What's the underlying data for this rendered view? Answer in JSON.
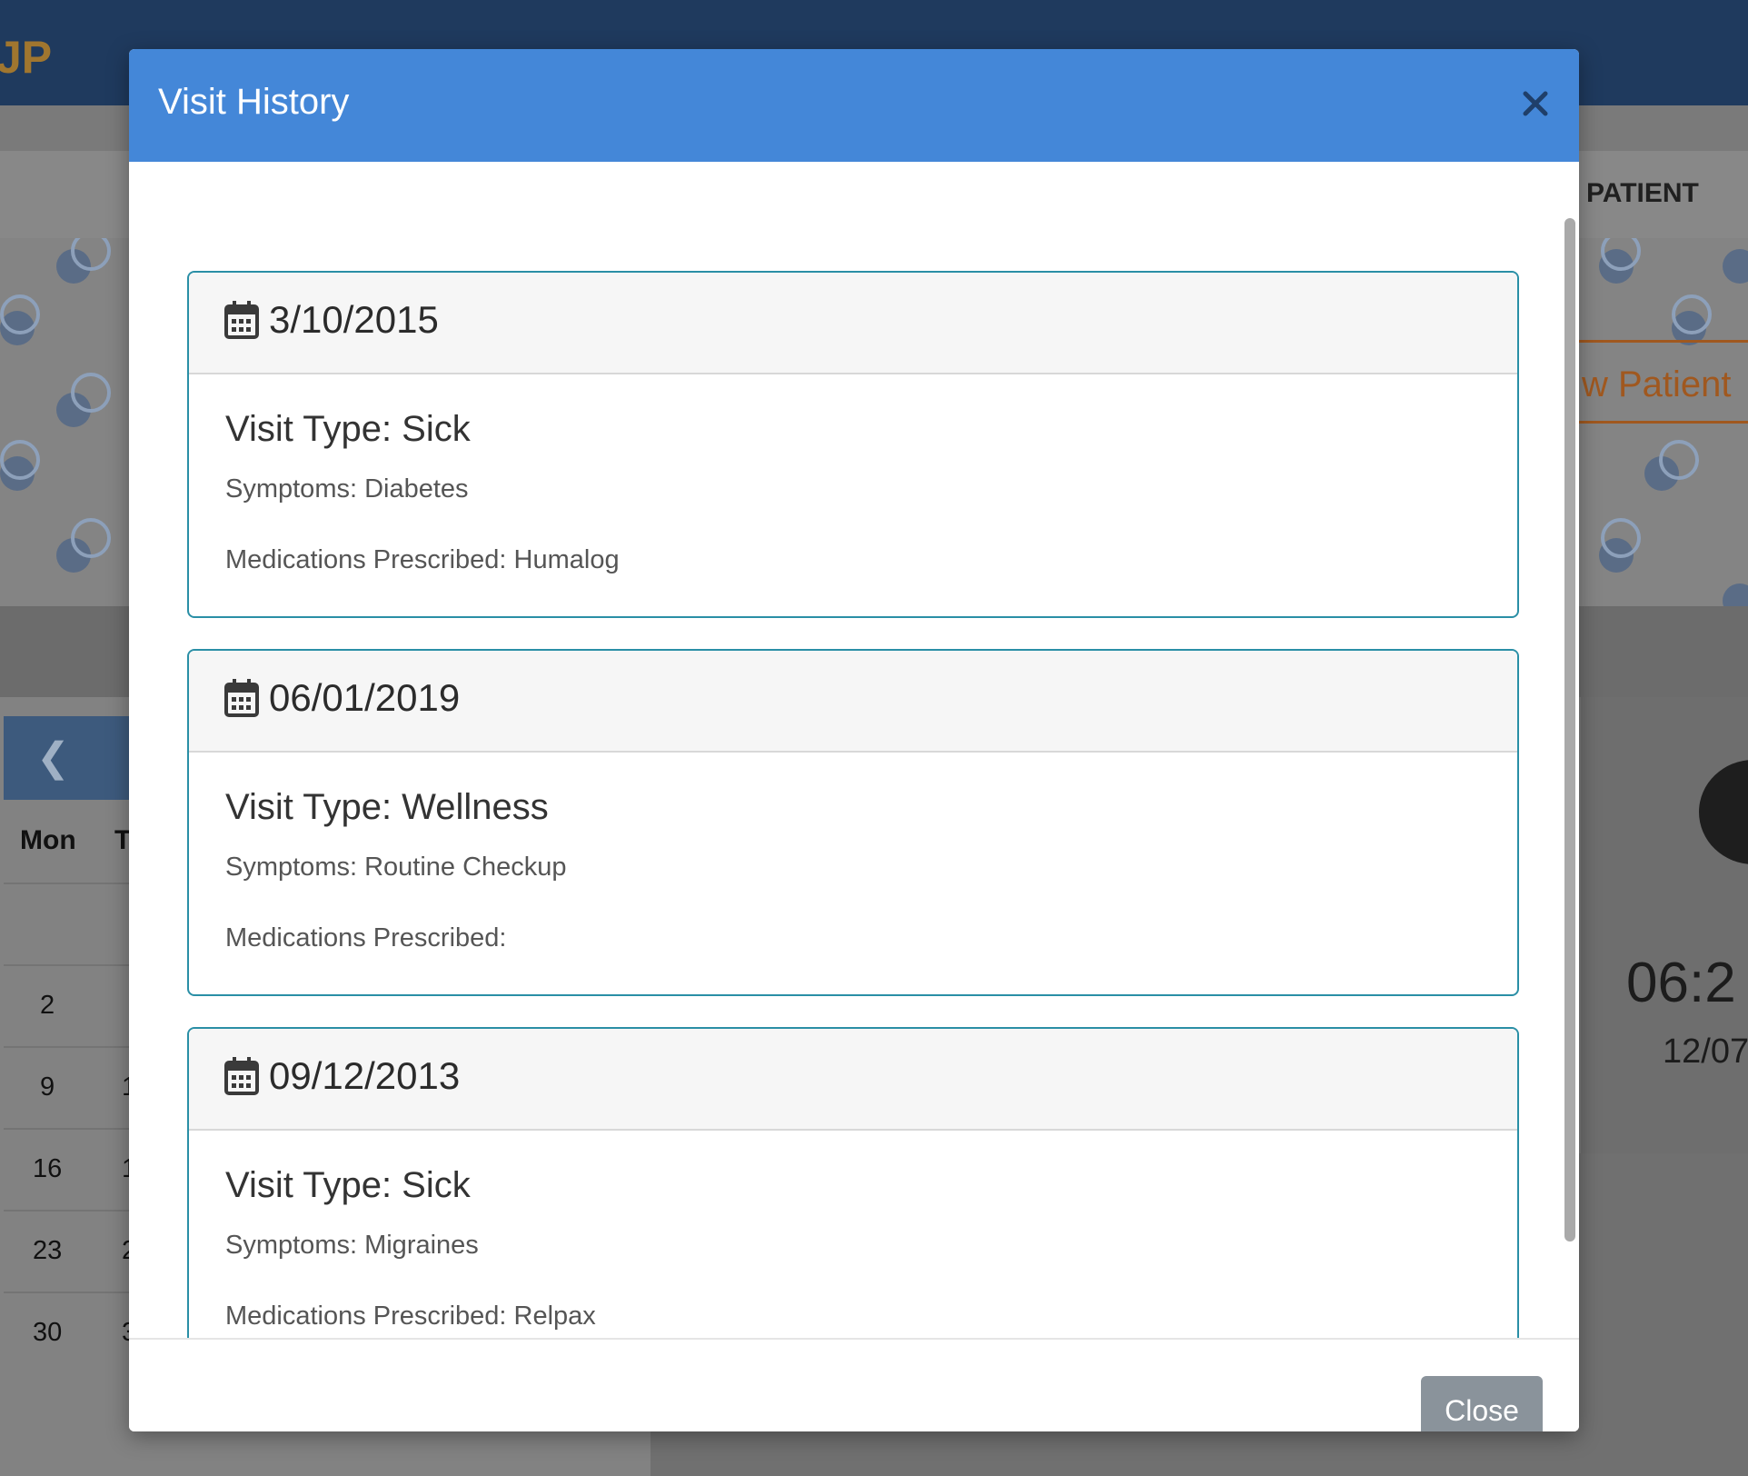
{
  "background": {
    "brand": "JP",
    "nav_item": "PATIENT",
    "new_patient_button": "w Patient",
    "calendar": {
      "prev_icon": "chevron-left-icon",
      "day_headers": [
        "Mon",
        "T"
      ],
      "rows": [
        {
          "mon": "",
          "tue": ""
        },
        {
          "mon": "2",
          "tue": ""
        },
        {
          "mon": "9",
          "tue": "1"
        },
        {
          "mon": "16",
          "tue": "1"
        },
        {
          "mon": "23",
          "tue": "2"
        },
        {
          "mon": "30",
          "tue": "3"
        }
      ]
    },
    "clock": {
      "time": "06:2",
      "date": "12/07"
    }
  },
  "modal": {
    "title": "Visit History",
    "close_icon": "close-icon",
    "visits": [
      {
        "date": "3/10/2015",
        "visit_type": "Visit Type: Sick",
        "symptoms": "Symptoms: Diabetes",
        "medications": "Medications Prescribed: Humalog"
      },
      {
        "date": "06/01/2019",
        "visit_type": "Visit Type: Wellness",
        "symptoms": "Symptoms: Routine Checkup",
        "medications": "Medications Prescribed:"
      },
      {
        "date": "09/12/2013",
        "visit_type": "Visit Type: Sick",
        "symptoms": "Symptoms: Migraines",
        "medications": "Medications Prescribed: Relpax"
      }
    ],
    "close_button": "Close"
  },
  "colors": {
    "modal_header": "#4487d8",
    "card_border": "#2a8fa6",
    "close_button": "#8a939b",
    "overlay_topbar": "#1f3a5e"
  }
}
